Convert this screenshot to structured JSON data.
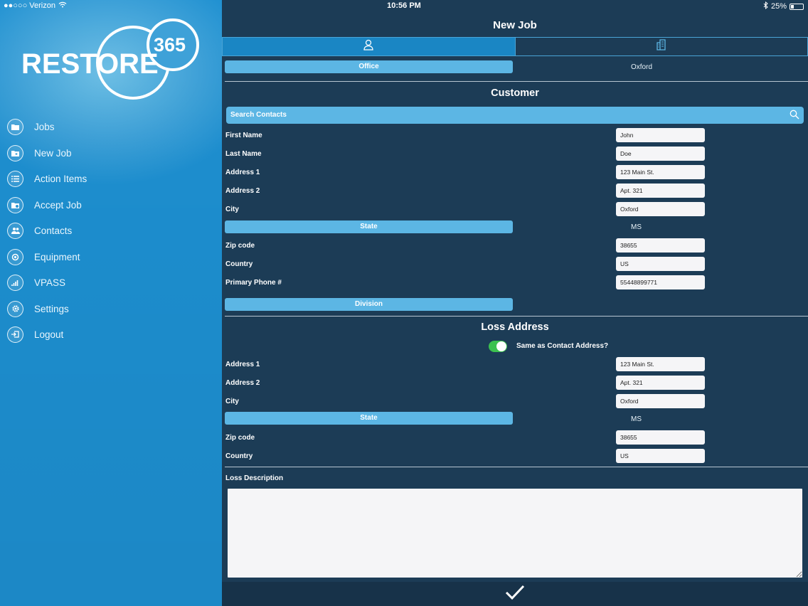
{
  "status_bar": {
    "carrier": "●●○○○ Verizon",
    "time": "10:56 PM",
    "battery": "25%",
    "battery_level": 0.25
  },
  "sidebar": {
    "logo_text": "RESTORE",
    "logo_number": "365",
    "items": [
      {
        "label": "Jobs",
        "icon": "folder-icon"
      },
      {
        "label": "New Job",
        "icon": "new-folder-icon"
      },
      {
        "label": "Action Items",
        "icon": "list-icon"
      },
      {
        "label": "Accept Job",
        "icon": "accept-folder-icon"
      },
      {
        "label": "Contacts",
        "icon": "contacts-icon"
      },
      {
        "label": "Equipment",
        "icon": "equipment-icon"
      },
      {
        "label": "VPASS",
        "icon": "bar-chart-icon"
      },
      {
        "label": "Settings",
        "icon": "gear-icon"
      },
      {
        "label": "Logout",
        "icon": "logout-icon"
      }
    ]
  },
  "main": {
    "title": "New Job",
    "tabs": [
      {
        "icon": "person-icon",
        "active": true
      },
      {
        "icon": "building-icon",
        "active": false
      }
    ],
    "office": {
      "label": "Office",
      "value": "Oxford"
    },
    "customer": {
      "title": "Customer",
      "search_placeholder": "Search Contacts",
      "first_name": {
        "label": "First Name",
        "value": "John"
      },
      "last_name": {
        "label": "Last Name",
        "value": "Doe"
      },
      "address1": {
        "label": "Address 1",
        "value": "123 Main St."
      },
      "address2": {
        "label": "Address 2",
        "value": "Apt. 321"
      },
      "city": {
        "label": "City",
        "value": "Oxford"
      },
      "state": {
        "label": "State",
        "value": "MS"
      },
      "zip": {
        "label": "Zip code",
        "value": "38655"
      },
      "country": {
        "label": "Country",
        "value": "US"
      },
      "phone": {
        "label": "Primary Phone #",
        "value": "55448899771"
      },
      "division": {
        "label": "Division"
      }
    },
    "loss": {
      "title": "Loss Address",
      "same_as_contact": {
        "label": "Same as Contact Address?",
        "on": true
      },
      "address1": {
        "label": "Address 1",
        "value": "123 Main St."
      },
      "address2": {
        "label": "Address 2",
        "value": "Apt. 321"
      },
      "city": {
        "label": "City",
        "value": "Oxford"
      },
      "state": {
        "label": "State",
        "value": "MS"
      },
      "zip": {
        "label": "Zip code",
        "value": "38655"
      },
      "country": {
        "label": "Country",
        "value": "US"
      },
      "description": {
        "label": "Loss Description",
        "value": ""
      }
    },
    "submit_icon": "checkmark-icon"
  },
  "colors": {
    "sidebar": "#2b98d5",
    "main_bg": "#1c3c56",
    "pill": "#5cb6e4",
    "toggle_on": "#3cc14f"
  }
}
